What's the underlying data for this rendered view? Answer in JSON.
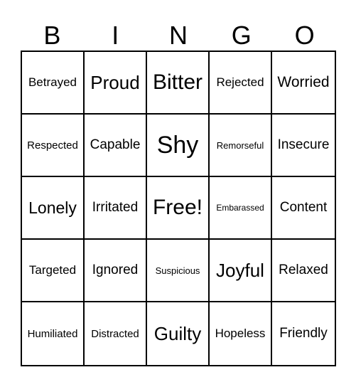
{
  "header": {
    "letters": [
      "B",
      "I",
      "N",
      "G",
      "O"
    ]
  },
  "card": {
    "rows": [
      [
        "Betrayed",
        "Proud",
        "Bitter",
        "Rejected",
        "Worried"
      ],
      [
        "Respected",
        "Capable",
        "Shy",
        "Remorseful",
        "Insecure"
      ],
      [
        "Lonely",
        "Irritated",
        "Free!",
        "Embarassed",
        "Content"
      ],
      [
        "Targeted",
        "Ignored",
        "Suspicious",
        "Joyful",
        "Relaxed"
      ],
      [
        "Humiliated",
        "Distracted",
        "Guilty",
        "Hopeless",
        "Friendly"
      ]
    ]
  }
}
